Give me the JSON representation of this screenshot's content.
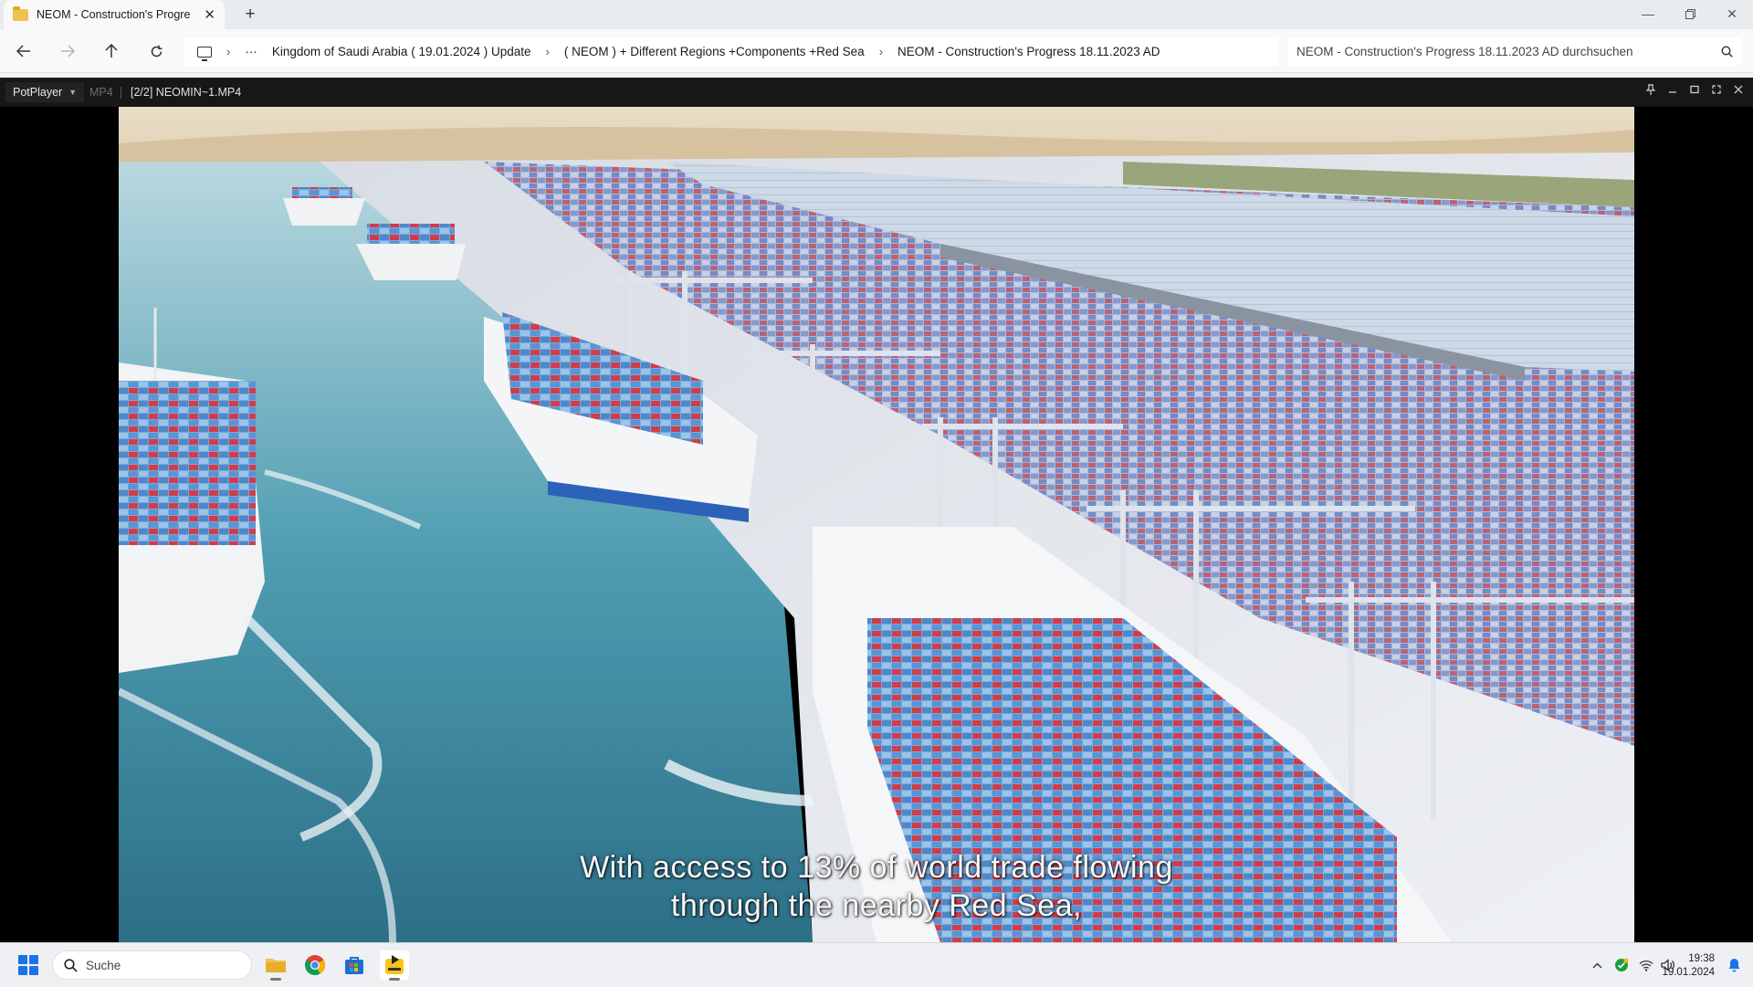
{
  "explorer": {
    "tab_title": "NEOM - Construction's Progre",
    "breadcrumbs": [
      "Kingdom of Saudi Arabia ( 19.01.2024 ) Update",
      "( NEOM ) + Different Regions +Components +Red Sea",
      "NEOM - Construction's Progress 18.11.2023 AD"
    ],
    "overflow_label": "···",
    "search_placeholder": "NEOM - Construction's Progress 18.11.2023 AD durchsuchen"
  },
  "player": {
    "brand": "PotPlayer",
    "format": "MP4",
    "file_label": "[2/2] NEOMIN~1.MP4",
    "subtitle_line1": "With access to 13% of world trade flowing",
    "subtitle_line2": "through the nearby Red Sea,"
  },
  "taskbar": {
    "search_label": "Suche",
    "pinned_apps": [
      "file-explorer",
      "chrome",
      "microsoft-store",
      "potplayer"
    ],
    "time": "19:38",
    "date": "19.01.2024"
  },
  "colors": {
    "accent": "#1a73e8",
    "player_bar": "#171717",
    "sea": "#3b8fa8"
  }
}
